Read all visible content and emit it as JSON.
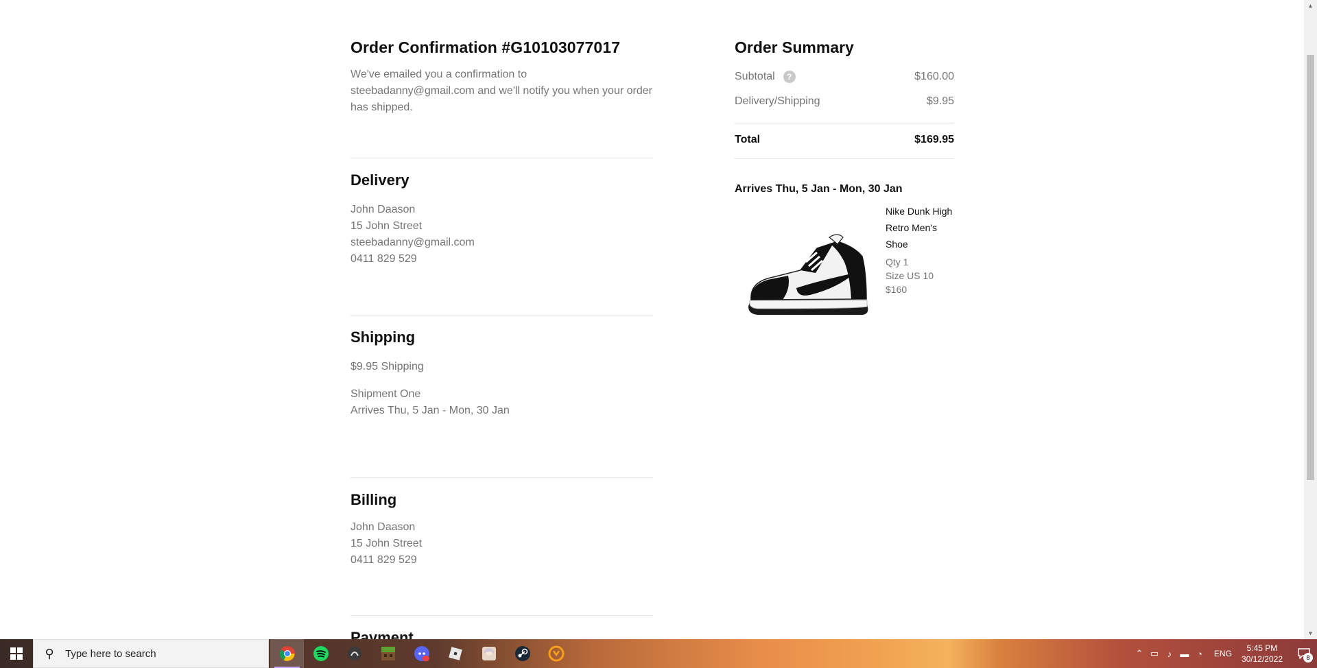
{
  "order": {
    "title": "Order Confirmation #G10103077017",
    "intro": "We've emailed you a confirmation to steebadanny@gmail.com and we'll notify you when your order has shipped."
  },
  "delivery": {
    "title": "Delivery",
    "name": "John Daason",
    "street": "15 John Street",
    "email": "steebadanny@gmail.com",
    "phone": "0411 829 529"
  },
  "shipping": {
    "title": "Shipping",
    "cost": "$9.95 Shipping",
    "shipment": "Shipment One",
    "arrives": "Arrives Thu, 5 Jan - Mon, 30 Jan"
  },
  "billing": {
    "title": "Billing",
    "name": "John Daason",
    "street": "15 John Street",
    "phone": "0411 829 529"
  },
  "payment": {
    "title": "Payment"
  },
  "summary": {
    "title": "Order Summary",
    "subtotal_label": "Subtotal",
    "subtotal_help": "?",
    "subtotal_value": "$160.00",
    "delivery_label": "Delivery/Shipping",
    "delivery_value": "$9.95",
    "total_label": "Total",
    "total_value": "$169.95",
    "arrives": "Arrives Thu, 5 Jan - Mon, 30 Jan"
  },
  "product": {
    "name": "Nike Dunk High Retro Men's Shoe",
    "qty": "Qty 1",
    "size": "Size US 10",
    "price": "$160",
    "image_icon": "shoe-image"
  },
  "taskbar": {
    "search_placeholder": "Type here to search",
    "apps": [
      "chrome-icon",
      "spotify-icon",
      "app-icon",
      "minecraft-icon",
      "discord-icon",
      "roblox-icon",
      "anime-app-icon",
      "steam-icon",
      "overwatch-icon"
    ],
    "lang": "ENG",
    "time": "5:45 PM",
    "date": "30/12/2022",
    "notification_count": "8"
  },
  "colors": {
    "muted_text": "#757575",
    "divider": "#e5e5e5",
    "primary_text": "#111111"
  }
}
